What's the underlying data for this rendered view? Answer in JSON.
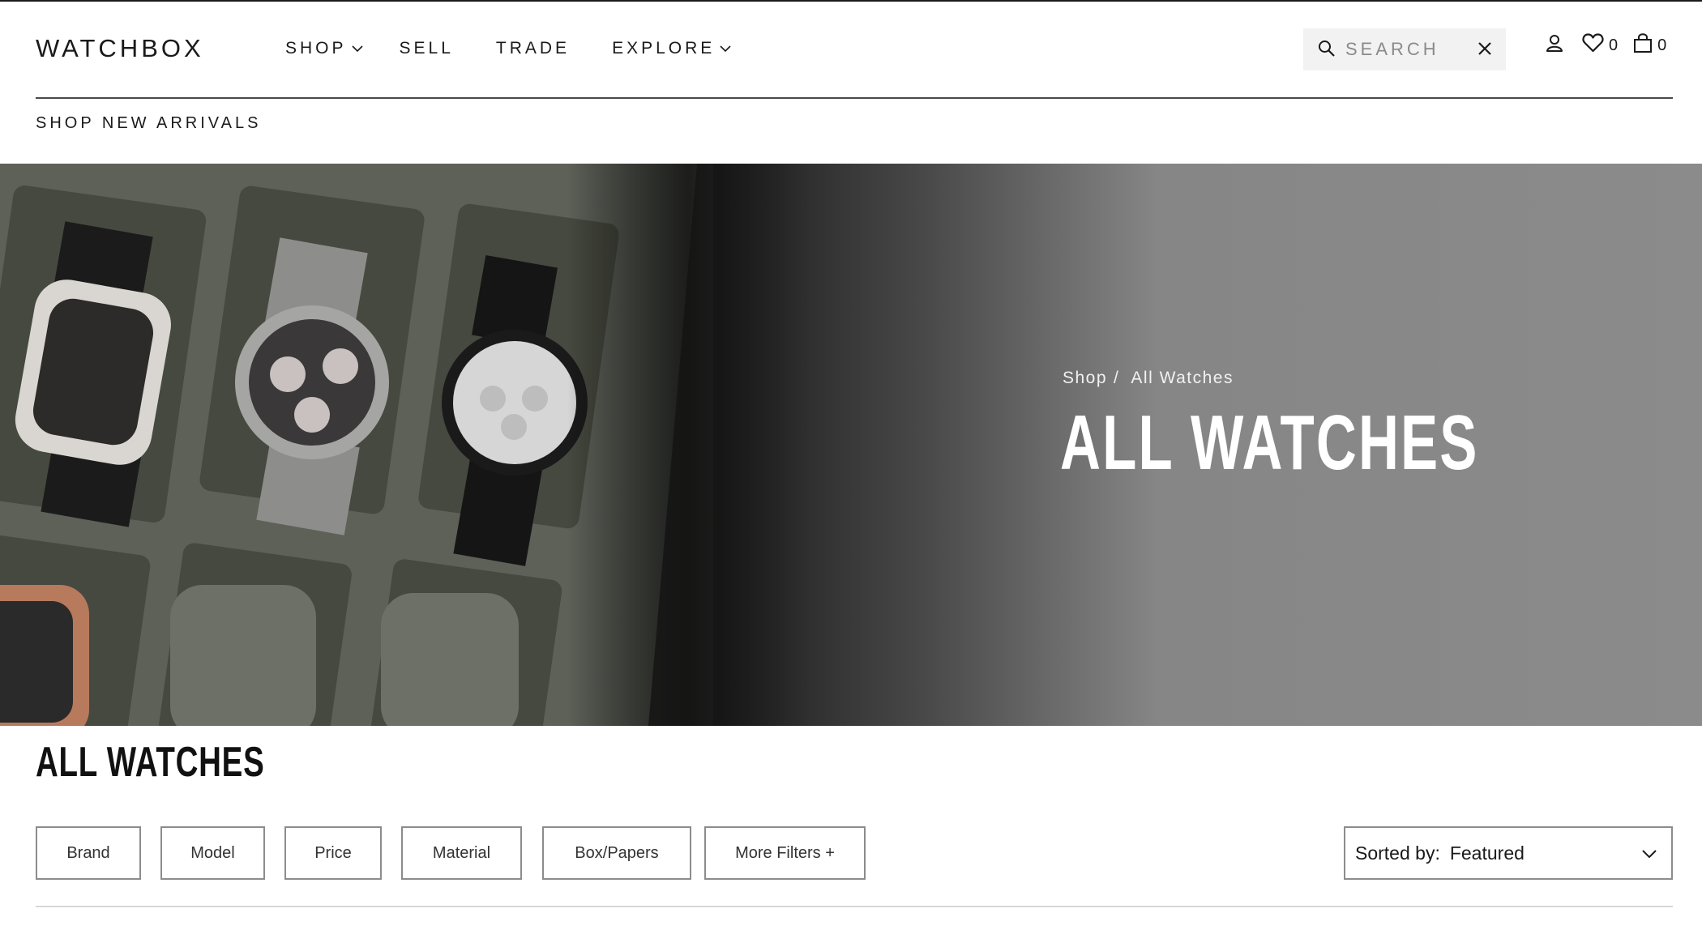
{
  "header": {
    "logo": "WATCHBOX",
    "nav": [
      {
        "label": "SHOP",
        "has_dropdown": true
      },
      {
        "label": "SELL",
        "has_dropdown": false
      },
      {
        "label": "TRADE",
        "has_dropdown": false
      },
      {
        "label": "EXPLORE",
        "has_dropdown": true
      }
    ],
    "search": {
      "placeholder": "SEARCH",
      "value": ""
    },
    "wishlist_count": "0",
    "cart_count": "0",
    "sub_nav_link": "SHOP NEW ARRIVALS"
  },
  "hero": {
    "breadcrumb": [
      "Shop",
      "All Watches"
    ],
    "breadcrumb_sep": "/",
    "title": "ALL WATCHES"
  },
  "main": {
    "title": "ALL WATCHES",
    "filters": [
      "Brand",
      "Model",
      "Price",
      "Material",
      "Box/Papers",
      "More Filters +"
    ],
    "sort": {
      "label": "Sorted by:",
      "value": "Featured"
    }
  },
  "colors": {
    "text": "#1a1a1a",
    "border": "#8c8c8c",
    "search_bg": "#f2f2f2",
    "hero_text": "#ffffff"
  }
}
